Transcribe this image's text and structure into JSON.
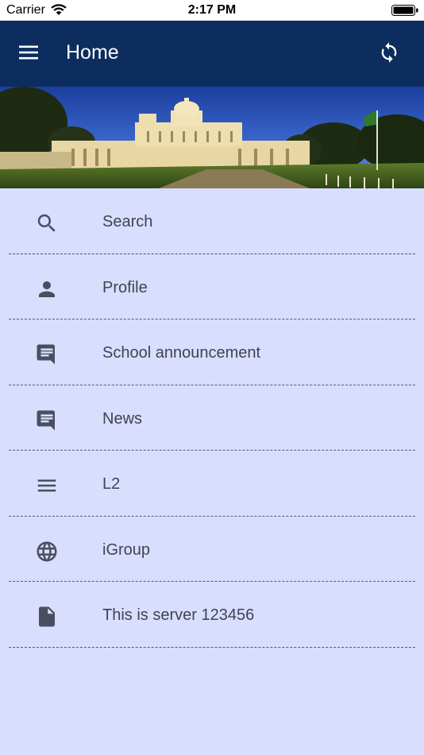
{
  "status_bar": {
    "carrier": "Carrier",
    "time": "2:17 PM"
  },
  "app_bar": {
    "title": "Home",
    "menu_icon": "hamburger-menu-icon",
    "sync_icon": "sync-icon"
  },
  "colors": {
    "app_bar": "#0d2d5f",
    "background": "#d9deff",
    "icon": "#4a4f60",
    "text": "#3f4350"
  },
  "menu": {
    "items": [
      {
        "label": "Search",
        "icon": "search-icon"
      },
      {
        "label": "Profile",
        "icon": "person-icon"
      },
      {
        "label": "School announcement",
        "icon": "chat-message-icon"
      },
      {
        "label": "News",
        "icon": "chat-message-icon"
      },
      {
        "label": "L2",
        "icon": "list-lines-icon"
      },
      {
        "label": "iGroup",
        "icon": "globe-icon"
      },
      {
        "label": "This is server 123456",
        "icon": "document-icon"
      }
    ]
  }
}
